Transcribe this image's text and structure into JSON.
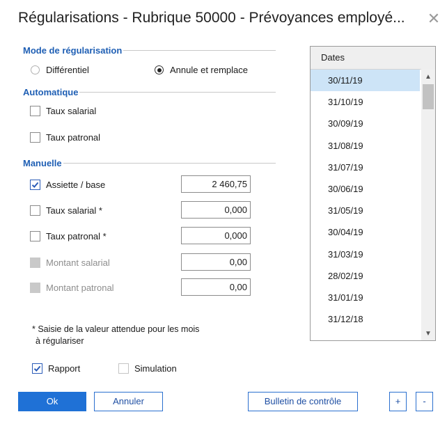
{
  "window": {
    "title": "Régularisations - Rubrique 50000 - Prévoyances employé...",
    "close_glyph": "✕"
  },
  "mode": {
    "heading": "Mode de régularisation",
    "options": [
      {
        "label": "Différentiel",
        "selected": false
      },
      {
        "label": "Annule et remplace",
        "selected": true
      }
    ]
  },
  "automatique": {
    "heading": "Automatique",
    "items": [
      {
        "label": "Taux salarial",
        "checked": false
      },
      {
        "label": "Taux patronal",
        "checked": false
      }
    ]
  },
  "manuelle": {
    "heading": "Manuelle",
    "items": [
      {
        "label": "Assiette / base",
        "checked": true,
        "disabled": false,
        "value": "2 460,75"
      },
      {
        "label": "Taux salarial *",
        "checked": false,
        "disabled": false,
        "value": "0,000"
      },
      {
        "label": "Taux patronal *",
        "checked": false,
        "disabled": false,
        "value": "0,000"
      },
      {
        "label": "Montant salarial",
        "checked": false,
        "disabled": true,
        "value": "0,00"
      },
      {
        "label": "Montant patronal",
        "checked": false,
        "disabled": true,
        "value": "0,00"
      }
    ]
  },
  "note": {
    "line1": "* Saisie de la valeur attendue pour les mois",
    "line2": "à régulariser"
  },
  "options": {
    "rapport": {
      "label": "Rapport",
      "checked": true
    },
    "simulation": {
      "label": "Simulation",
      "checked": false
    }
  },
  "dates": {
    "header": "Dates",
    "rows": [
      "30/11/19",
      "31/10/19",
      "30/09/19",
      "31/08/19",
      "31/07/19",
      "30/06/19",
      "31/05/19",
      "30/04/19",
      "31/03/19",
      "28/02/19",
      "31/01/19",
      "31/12/18"
    ],
    "selected_index": 0,
    "scroll_up_glyph": "▲",
    "scroll_down_glyph": "▼"
  },
  "buttons": {
    "ok": "Ok",
    "annuler": "Annuler",
    "bulletin": "Bulletin de contrôle",
    "plus": "+",
    "minus": "-"
  },
  "colors": {
    "accent": "#1f71d6",
    "section_heading": "#1f5fb4",
    "selected_row": "#cde4f7"
  }
}
